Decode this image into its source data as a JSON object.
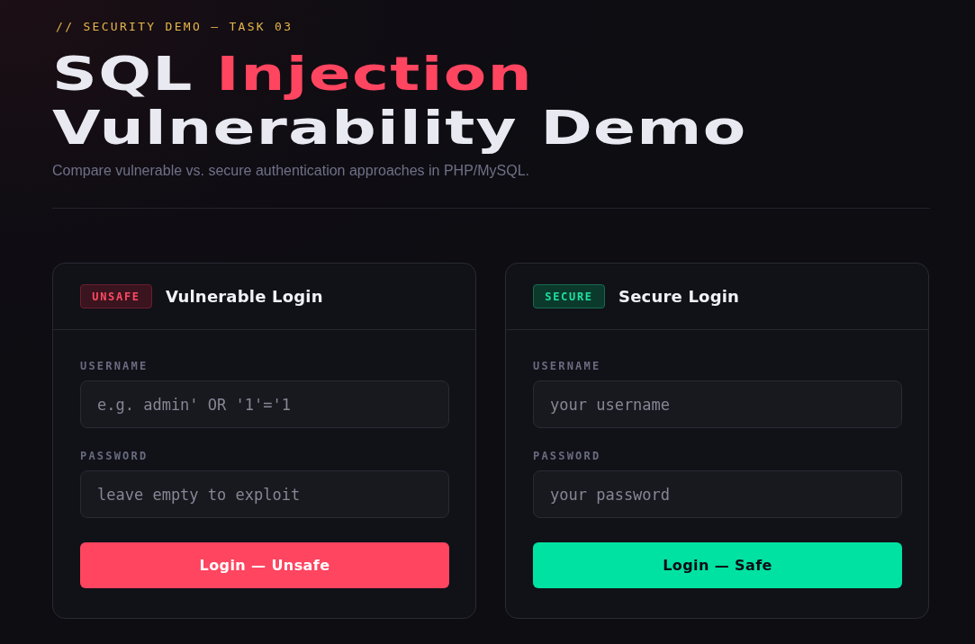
{
  "header": {
    "eyebrow": "// SECURITY DEMO — TASK 03",
    "title": "SQL **Injection** Vulnerability Demo",
    "subtitle": "Compare vulnerable vs. secure authentication approaches in PHP/MySQL."
  },
  "panels": [
    {
      "kind": "unsafe",
      "badge": "UNSAFE",
      "title": "Vulnerable Login",
      "fields": [
        {
          "label": "USERNAME",
          "placeholder": "e.g. admin' OR '1'='1"
        },
        {
          "label": "PASSWORD",
          "placeholder": "leave empty to exploit"
        }
      ],
      "button": "Login — Unsafe"
    },
    {
      "kind": "secure",
      "badge": "SECURE",
      "title": "Secure Login",
      "fields": [
        {
          "label": "USERNAME",
          "placeholder": "your username"
        },
        {
          "label": "PASSWORD",
          "placeholder": "your password"
        }
      ],
      "button": "Login — Safe"
    }
  ]
}
